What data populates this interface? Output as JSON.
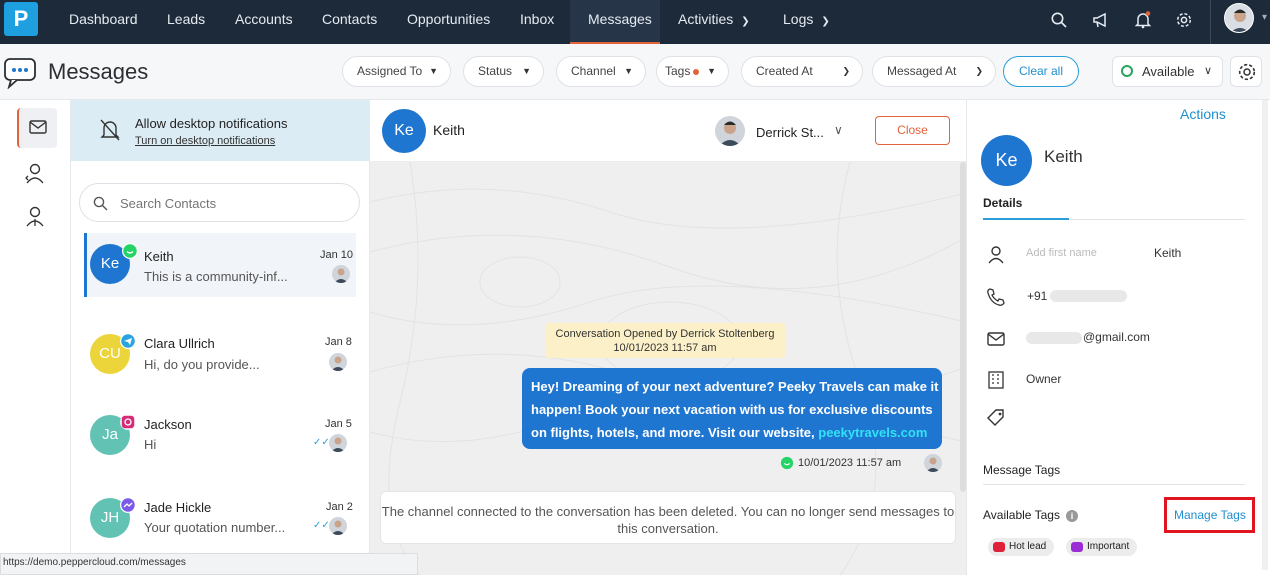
{
  "app": {
    "logo_letter": "P"
  },
  "nav": {
    "items": [
      {
        "label": "Dashboard"
      },
      {
        "label": "Leads"
      },
      {
        "label": "Accounts"
      },
      {
        "label": "Contacts"
      },
      {
        "label": "Opportunities"
      },
      {
        "label": "Inbox"
      },
      {
        "label": "Messages",
        "active": true
      },
      {
        "label": "Activities",
        "dropdown": true
      },
      {
        "label": "Logs",
        "dropdown": true
      }
    ],
    "icons": [
      "search-icon",
      "megaphone-icon",
      "bell-icon",
      "gear-icon"
    ],
    "accent": "#e2623a",
    "background": "#1d2a3a"
  },
  "subheader": {
    "title": "Messages",
    "filters": [
      "Assigned To",
      "Status",
      "Channel",
      "Tags",
      "Created At",
      "Messaged At"
    ],
    "clear_all": "Clear all",
    "availability": "Available"
  },
  "notification": {
    "title": "Allow desktop notifications",
    "link": "Turn on desktop notifications"
  },
  "search": {
    "placeholder": "Search Contacts"
  },
  "contacts": [
    {
      "initials": "Ke",
      "name": "Keith",
      "date": "Jan 10",
      "preview": "This is a community-inf...",
      "channel": "whatsapp",
      "color": "#1f76d1"
    },
    {
      "initials": "CU",
      "name": "Clara Ullrich",
      "date": "Jan 8",
      "preview": "Hi, do you provide...",
      "channel": "telegram",
      "color": "#ecd53a"
    },
    {
      "initials": "Ja",
      "name": "Jackson",
      "date": "Jan 5",
      "preview": "Hi",
      "channel": "instagram",
      "color": "#62c3b5"
    },
    {
      "initials": "JH",
      "name": "Jade Hickle",
      "date": "Jan 2",
      "preview": "Your quotation number...",
      "channel": "messenger",
      "color": "#62c3b5"
    }
  ],
  "chat": {
    "contact_initials": "Ke",
    "contact_name": "Keith",
    "assignee": "Derrick St...",
    "close_label": "Close",
    "system_note_line1": "Conversation Opened by Derrick Stoltenberg",
    "system_note_line2": "10/01/2023 11:57 am",
    "message_text": "Hey! Dreaming of your next adventure? Peeky Travels can make it happen! Book your next vacation with us for exclusive discounts on flights, hotels, and more. Visit our website,",
    "message_link": "peekytravels.com",
    "message_time": "10/01/2023 11:57 am",
    "deleted_notice": "The channel connected to the conversation has been deleted. You can no longer send messages to this conversation."
  },
  "details": {
    "actions": "Actions",
    "initials": "Ke",
    "name": "Keith",
    "tab": "Details",
    "first_name_placeholder": "Add first name",
    "first_name": "Keith",
    "phone_prefix": "+91",
    "email_suffix": "@gmail.com",
    "role": "Owner",
    "message_tags_title": "Message Tags",
    "available_tags_title": "Available Tags",
    "manage_tags": "Manage Tags",
    "tags": [
      {
        "label": "Hot lead",
        "color": "#e0203a"
      },
      {
        "label": "Important",
        "color": "#9b2dd6"
      }
    ]
  },
  "statusbar": {
    "url": "https://demo.peppercloud.com/messages"
  }
}
